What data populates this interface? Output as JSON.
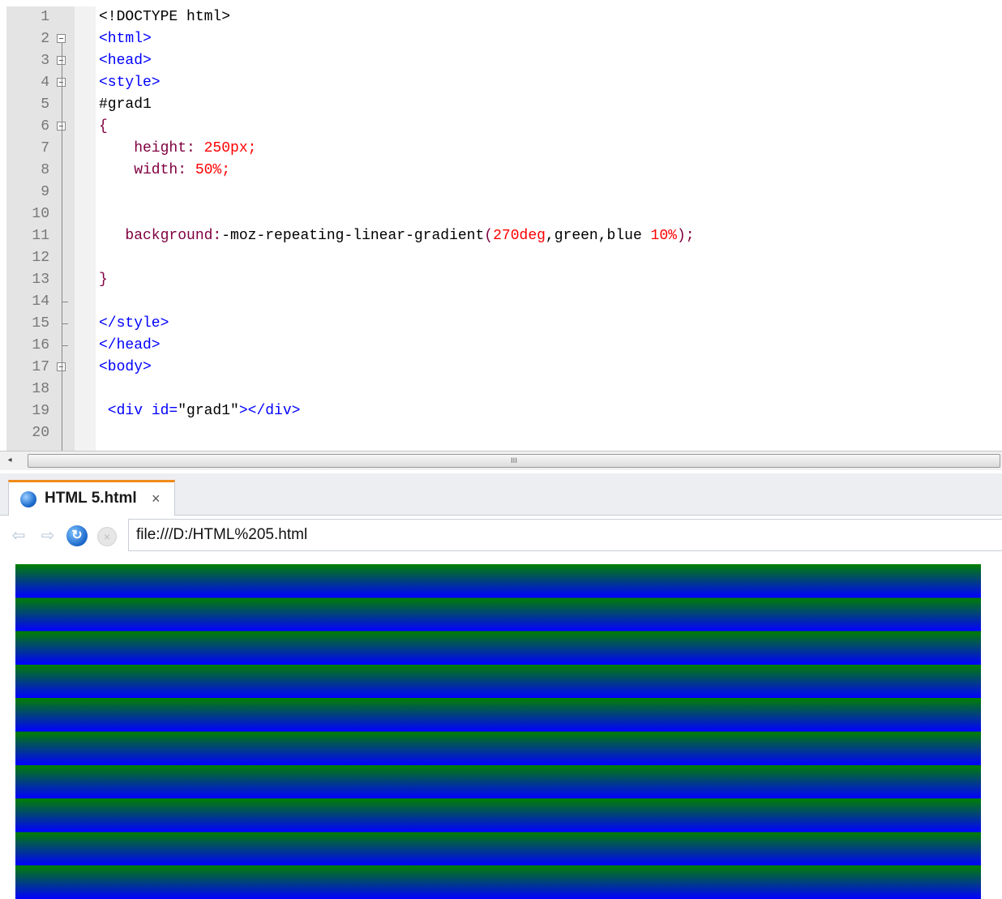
{
  "editor": {
    "lines": [
      {
        "num": "1",
        "tokens": [
          {
            "t": "<!DOCTYPE html>",
            "c": "plain"
          }
        ]
      },
      {
        "num": "2",
        "tokens": [
          {
            "t": "<html>",
            "c": "tag"
          }
        ]
      },
      {
        "num": "3",
        "tokens": [
          {
            "t": "<head>",
            "c": "tag"
          }
        ]
      },
      {
        "num": "4",
        "tokens": [
          {
            "t": "<style>",
            "c": "tag"
          }
        ]
      },
      {
        "num": "5",
        "tokens": [
          {
            "t": "#grad1",
            "c": "plain"
          }
        ]
      },
      {
        "num": "6",
        "tokens": [
          {
            "t": "{",
            "c": "prop"
          }
        ]
      },
      {
        "num": "7",
        "tokens": [
          {
            "t": "    height: ",
            "c": "prop"
          },
          {
            "t": "250px;",
            "c": "num"
          }
        ]
      },
      {
        "num": "8",
        "tokens": [
          {
            "t": "    width: ",
            "c": "prop"
          },
          {
            "t": "50%;",
            "c": "num"
          }
        ]
      },
      {
        "num": "9",
        "tokens": []
      },
      {
        "num": "10",
        "tokens": []
      },
      {
        "num": "11",
        "tokens": [
          {
            "t": "   background:",
            "c": "prop"
          },
          {
            "t": "-moz-repeating-linear-gradient",
            "c": "val"
          },
          {
            "t": "(",
            "c": "prop"
          },
          {
            "t": "270deg",
            "c": "num"
          },
          {
            "t": ",green,blue ",
            "c": "val"
          },
          {
            "t": "10%",
            "c": "num"
          },
          {
            "t": ");",
            "c": "prop"
          }
        ]
      },
      {
        "num": "12",
        "tokens": []
      },
      {
        "num": "13",
        "tokens": [
          {
            "t": "}",
            "c": "prop"
          }
        ]
      },
      {
        "num": "14",
        "tokens": []
      },
      {
        "num": "15",
        "tokens": [
          {
            "t": "</style>",
            "c": "tag"
          }
        ]
      },
      {
        "num": "16",
        "tokens": [
          {
            "t": "</head>",
            "c": "tag"
          }
        ]
      },
      {
        "num": "17",
        "tokens": [
          {
            "t": "<body>",
            "c": "tag"
          }
        ]
      },
      {
        "num": "18",
        "tokens": []
      },
      {
        "num": "19",
        "tokens": [
          {
            "t": " <div ",
            "c": "tag"
          },
          {
            "t": "id=",
            "c": "tag"
          },
          {
            "t": "\"grad1\"",
            "c": "plain"
          },
          {
            "t": "></div>",
            "c": "tag"
          }
        ]
      },
      {
        "num": "20",
        "tokens": []
      }
    ]
  },
  "scrollbar": {
    "grip": "III"
  },
  "browser": {
    "tab": {
      "title": "HTML 5.html",
      "close_glyph": "×"
    },
    "nav": {
      "back_glyph": "⇦",
      "forward_glyph": "⇨",
      "reload_glyph": "↻",
      "stop_glyph": "×"
    },
    "url": "file:///D:/HTML%205.html",
    "gradient": {
      "colors": [
        "#008000",
        "#0000ff"
      ],
      "stripe_count": 10
    }
  }
}
